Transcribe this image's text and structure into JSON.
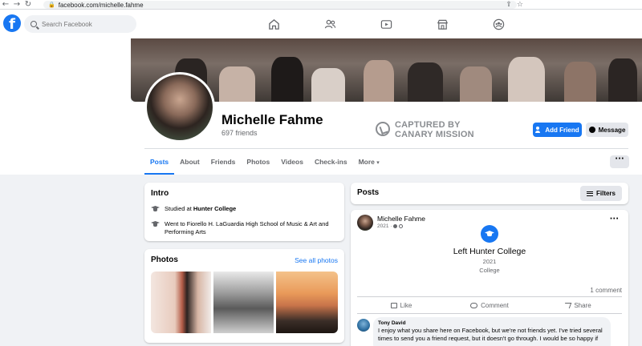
{
  "browser": {
    "url": "facebook.com/michelle.fahme",
    "back_glyph": "←",
    "forward_glyph": "→",
    "reload_glyph": "↻",
    "lock_glyph": "🔒",
    "share_glyph": "⇪",
    "star_glyph": "☆"
  },
  "topbar": {
    "logo_letter": "f",
    "search_placeholder": "Search Facebook",
    "nav_icons": [
      "home-icon",
      "friends-icon",
      "watch-icon",
      "marketplace-icon",
      "groups-icon"
    ]
  },
  "profile": {
    "name": "Michelle Fahme",
    "friends": "697 friends",
    "stamp_line1": "CAPTURED BY",
    "stamp_line2": "CANARY MISSION",
    "add_friend": "Add Friend",
    "message": "Message",
    "more_dots": "···"
  },
  "tabs": {
    "items": [
      "Posts",
      "About",
      "Friends",
      "Photos",
      "Videos",
      "Check-ins",
      "More"
    ],
    "active": "Posts",
    "more_caret": "▾"
  },
  "intro": {
    "title": "Intro",
    "studied_prefix": "Studied at ",
    "studied_school": "Hunter College",
    "went_to": "Went to Fiorello H. LaGuardia High School of Music & Art and Performing Arts"
  },
  "photos": {
    "title": "Photos",
    "see_all": "See all photos"
  },
  "posts_header": {
    "title": "Posts",
    "filters": "Filters"
  },
  "post": {
    "author": "Michelle Fahme",
    "date": "2021 ·",
    "more": "···",
    "event_title": "Left Hunter College",
    "event_year": "2021",
    "event_type": "College",
    "comment_count": "1 comment",
    "like": "Like",
    "comment": "Comment",
    "share": "Share"
  },
  "comment": {
    "author": "Tony David",
    "text": "I enjoy what you share here on Facebook, but we're not friends yet. I've tried several times to send you a friend request, but it doesn't go through. I would be so happy if"
  },
  "colors": {
    "brand": "#1877f2",
    "background": "#f0f2f5",
    "secondary_text": "#65676b",
    "stamp": "#8a8d91"
  }
}
